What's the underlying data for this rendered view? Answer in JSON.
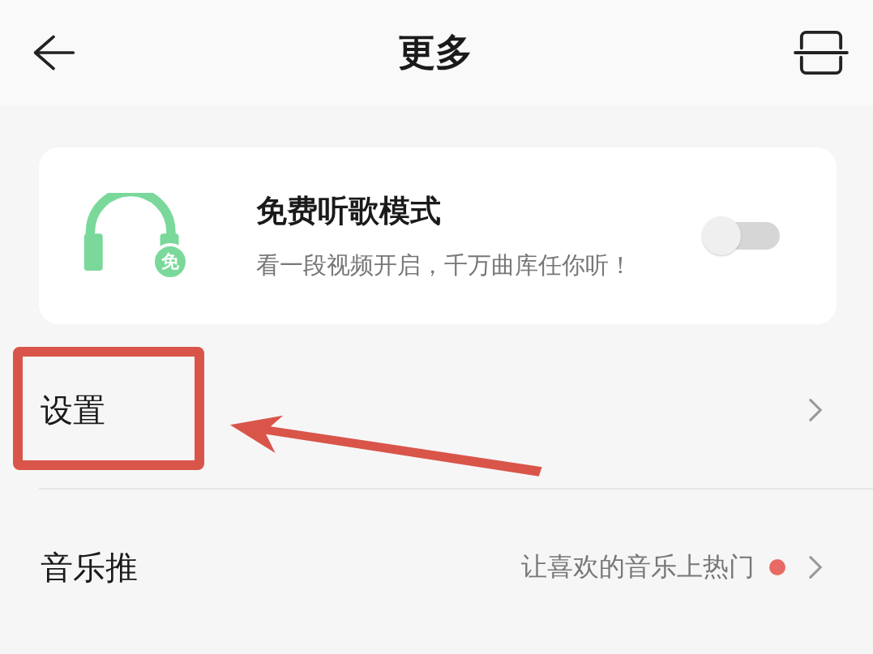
{
  "header": {
    "title": "更多"
  },
  "promo": {
    "title": "免费听歌模式",
    "subtitle": "看一段视频开启，千万曲库任你听！",
    "badge": "免",
    "on": false
  },
  "rows": [
    {
      "label": "设置",
      "hint": null,
      "dot": false,
      "highlighted": true
    },
    {
      "label": "音乐推",
      "hint": "让喜欢的音乐上热门",
      "dot": true,
      "highlighted": false
    }
  ]
}
